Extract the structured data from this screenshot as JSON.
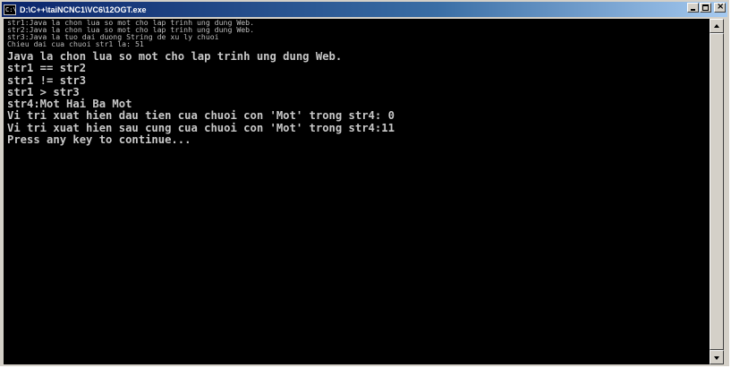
{
  "window": {
    "title": "D:\\C++\\taiNCNC1\\VC6\\12OGT.exe",
    "icon": "console-app-icon",
    "buttons": [
      "minimize-icon",
      "maximize-icon",
      "close-icon"
    ]
  },
  "console": {
    "old_lines": [
      "str1:Java la chon lua so mot cho lap trinh ung dung Web.",
      "str2:Java la chon lua so mot cho lap trinh ung dung Web.",
      "str3:Java la tuo dai duong String de xu ly chuoi",
      "Chieu dai cua chuoi str1 la: 51"
    ],
    "lines": [
      "Java la chon lua so mot cho lap trinh ung dung Web.",
      "str1 == str2",
      "str1 != str3",
      "str1 > str3",
      "str4:Mot Hai Ba Mot",
      "Vi tri xuat hien dau tien cua chuoi con 'Mot' trong str4: 0",
      "Vi tri xuat hien sau cung cua chuoi con 'Mot' trong str4:11",
      "Press any key to continue..."
    ]
  },
  "colors": {
    "console_bg": "#000000",
    "console_text": "#c0c0c0",
    "titlebar_start": "#0a246a",
    "titlebar_end": "#a6caf0"
  }
}
